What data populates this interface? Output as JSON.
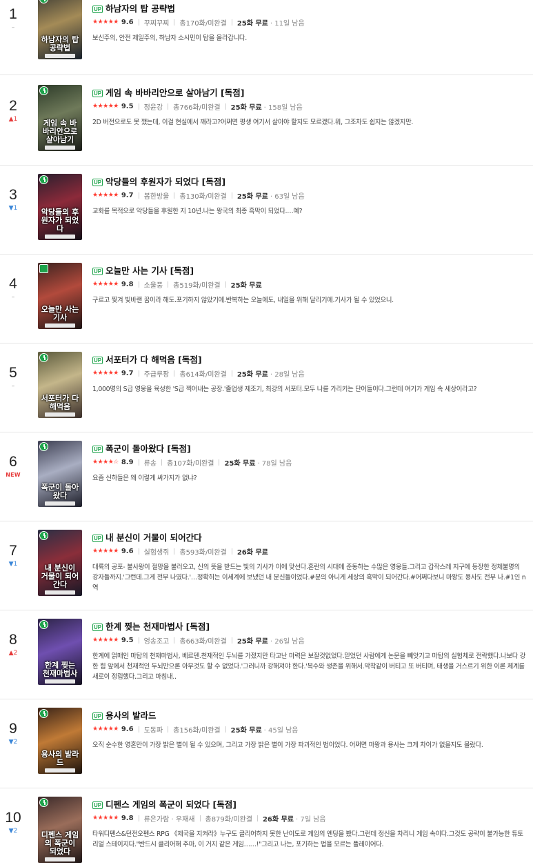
{
  "items": [
    {
      "rank": "1",
      "delta": "–",
      "delta_type": "same",
      "title": "하남자의 탑 공략법",
      "stars": "★★★★★",
      "score": "9.6",
      "author": "꾸찌꾸찌",
      "episodes": "총170화/미완결",
      "free": "25화 무료",
      "remain": "· 11일 남음",
      "desc": "보신주의, 안전 제일주의, 하남자 소시민이 탑을 올라갑니다.",
      "cover_text": "하남자의 탑 공략법",
      "cover_colors": [
        "#3b3a33",
        "#a48b57",
        "#17202b"
      ],
      "badge_icon": "clock-icon"
    },
    {
      "rank": "2",
      "delta": "▲1",
      "delta_type": "up",
      "title": "게임 속 바바리안으로 살아남기 [독점]",
      "stars": "★★★★★",
      "score": "9.5",
      "author": "정윤강",
      "episodes": "총766화/미완결",
      "free": "25화 무료",
      "remain": "· 158일 남음",
      "desc": "2D 버전으로도 못 깼는데, 이걸 현실에서 깨라고?어쩌면 평생 여기서 살아야 할지도 모르겠다.뭐, 그조차도 쉽지는 않겠지만.",
      "cover_text": "게임 속 바바리안으로 살아남기",
      "cover_colors": [
        "#2c3a28",
        "#6f7a5a",
        "#1a1c18"
      ],
      "badge_icon": "clock-icon"
    },
    {
      "rank": "3",
      "delta": "▼1",
      "delta_type": "down",
      "title": "악당들의 후원자가 되었다 [독점]",
      "stars": "★★★★★",
      "score": "9.7",
      "author": "봄한방울",
      "episodes": "총130화/미완결",
      "free": "25화 무료",
      "remain": "· 63일 남음",
      "desc": "교화를 목적으로 악당들을 후원한 지 10년.나는 왕국의 최종 흑막이 되었다.…예?",
      "cover_text": "악당들의 후원자가 되었다",
      "cover_colors": [
        "#2a1f2e",
        "#8c2a3a",
        "#141018"
      ],
      "badge_icon": "clock-icon"
    },
    {
      "rank": "4",
      "delta": "–",
      "delta_type": "same",
      "title": "오늘만 사는 기사 [독점]",
      "stars": "★★★★★",
      "score": "9.8",
      "author": "소울풍",
      "episodes": "총519화/미완결",
      "free": "25화 무료",
      "remain": "",
      "desc": "구르고 찢겨 빛바랜 꿈이라 해도.포기하지 않았기에.반복하는 오늘에도, 내일을 위해 달리기에.기사가 될 수 있었으니.",
      "cover_text": "오늘만 사는 기사",
      "cover_colors": [
        "#3d2320",
        "#b24a3c",
        "#1d1414"
      ],
      "badge_icon": "gift-icon"
    },
    {
      "rank": "5",
      "delta": "–",
      "delta_type": "same",
      "title": "서포터가 다 해먹음 [독점]",
      "stars": "★★★★★",
      "score": "9.7",
      "author": "주급루팡",
      "episodes": "총614화/미완결",
      "free": "25화 무료",
      "remain": "· 28일 남음",
      "desc": "1,000명의 S급 영웅을 육성한 'S급 찍어내는 공장.'졸업생 제조기, 최강의 서포터.모두 나를 가리키는 단어들이다.그런데 여기가 게임 속 세상이라고?",
      "cover_text": "서포터가 다 해먹음",
      "cover_colors": [
        "#5b5a3c",
        "#c4b68a",
        "#3a2e2a"
      ],
      "badge_icon": "clock-icon"
    },
    {
      "rank": "6",
      "delta": "NEW",
      "delta_type": "new",
      "title": "폭군이 돌아왔다 [독점]",
      "stars": "★★★★☆",
      "score": "8.9",
      "author": "류송",
      "episodes": "총107화/미완결",
      "free": "25화 무료",
      "remain": "· 78일 남음",
      "desc": "요즘 신하들은 왜 이렇게 싸가지가 없냐?",
      "cover_text": "폭군이 돌아왔다",
      "cover_colors": [
        "#3d3f52",
        "#a9aec2",
        "#1c1d28"
      ],
      "badge_icon": "clock-icon"
    },
    {
      "rank": "7",
      "delta": "▼1",
      "delta_type": "down",
      "title": "내 분신이 거물이 되어간다",
      "stars": "★★★★★",
      "score": "9.6",
      "author": "실험생쥐",
      "episodes": "총593화/미완결",
      "free": "26화 무료",
      "remain": "",
      "desc": "대륙의 공포- 불사왕이 절망을 불러오고, 신의 뜻을 받드는 빛의 기사가 이에 맞선다.혼란의 시대에 준동하는 수많은 영웅들.그리고 갑작스레 지구에 등장한 정체불명의 강자들까지.'그런데.그게 전부 나였다.'…정확히는 이세계에 보냈던 내 분신들이었다.#분의 아니게 세상의 흑막이 되어간다.#어쩌다보니 마왕도 용사도 전부 나.#1인 n역",
      "cover_text": "내 분신이 거물이 되어간다",
      "cover_colors": [
        "#2a2f45",
        "#8a2e3a",
        "#151725"
      ],
      "badge_icon": "clock-icon"
    },
    {
      "rank": "8",
      "delta": "▲2",
      "delta_type": "up",
      "title": "한계 찢는 천재마법사 [독점]",
      "stars": "★★★★★",
      "score": "9.5",
      "author": "엉송조고",
      "episodes": "총663화/미완결",
      "free": "25화 무료",
      "remain": "· 26일 남음",
      "desc": "한계에 얽매인 마탑의 천재마법사, 베르덴.천재적인 두뇌를 가졌지만 타고난 마력은 보잘것없었다.믿었던 사람에게 논문을 빼앗기고 마탑의 실험체로 전락했다.나보다 강한 힘 앞에서 천재적인 두뇌만으론 아무것도 할 수 없었다.'그러니까 강해져야 한다.'복수와 생존을 위해서.악착같이 버티고 또 버티며, 태생을 거스르기 위한 이론 체계를 새로이 정립했다.그리고 마침내..",
      "cover_text": "한계 찢는 천재마법사",
      "cover_colors": [
        "#2d2448",
        "#6f4fb0",
        "#14111f"
      ],
      "badge_icon": "clock-icon"
    },
    {
      "rank": "9",
      "delta": "▼2",
      "delta_type": "down",
      "title": "용사의 발라드",
      "stars": "★★★★★",
      "score": "9.6",
      "author": "도동파",
      "episodes": "총156화/미완결",
      "free": "25화 무료",
      "remain": "· 45일 남음",
      "desc": "오직 순수한 영혼만이 가장 밝은 별이 될 수 있으며, 그리고 가장 밝은 별이 가장 파괴적인 법이었다. 어쩌면 마왕과 용사는 크게 차이가 없을지도 몰랐다.",
      "cover_text": "용사의 발라드",
      "cover_colors": [
        "#3a2418",
        "#c07a36",
        "#1b120c"
      ],
      "badge_icon": "clock-icon"
    },
    {
      "rank": "10",
      "delta": "▼2",
      "delta_type": "down",
      "title": "디펜스 게임의 폭군이 되었다 [독점]",
      "stars": "★★★★★",
      "score": "9.8",
      "author": "류은가람 · 우재새",
      "episodes": "총879화/미완결",
      "free": "26화 무료",
      "remain": "· 7일 남음",
      "desc": "타워디펜스&던전오펜스 RPG 《제국을 지켜라》누구도 클리어하지 못한 난이도로 게임의 엔딩을 봤다.그런데 정신을 차리니 게임 속이다.그것도 공략이 불가능한 튜토리얼 스테이지다.\"반드시 클리어해 주마, 이 거지 같은 게임……!\"그리고 나는, 포기하는 법을 모르는 플레이어다.",
      "cover_text": "디펜스 게임의 폭군이 되었다",
      "cover_colors": [
        "#3b2a2a",
        "#9a6d5a",
        "#1e1616"
      ],
      "badge_icon": "clock-icon"
    }
  ]
}
